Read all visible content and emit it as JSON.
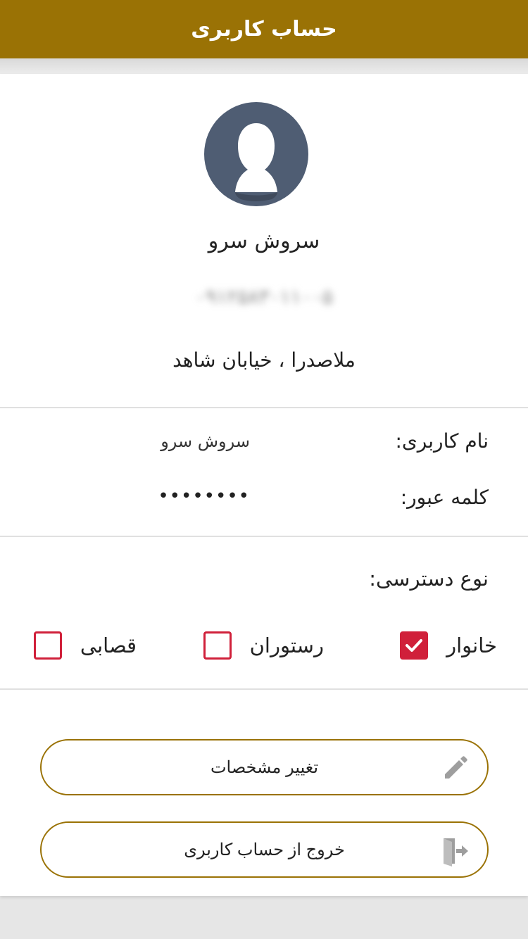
{
  "header": {
    "title": "حساب کاربری"
  },
  "profile": {
    "name": "سروش سرو",
    "phone": "۰۹۱۲۵۸۳۰۱۱۰۰۵",
    "address": "ملاصدرا ، خیابان شاهد",
    "avatar_icon": "user-silhouette-icon"
  },
  "account": {
    "username_label": "نام کاربری:",
    "username_value": "سروش سرو",
    "password_label": "کلمه عبور:",
    "password_value": "••••••••"
  },
  "access": {
    "title": "نوع دسترسی:",
    "options": [
      {
        "label": "خانوار",
        "checked": true
      },
      {
        "label": "رستوران",
        "checked": false
      },
      {
        "label": "قصابی",
        "checked": false
      }
    ]
  },
  "actions": {
    "edit_label": "تغییر مشخصات",
    "edit_icon": "pencil-icon",
    "logout_label": "خروج از حساب کاربری",
    "logout_icon": "exit-door-icon"
  },
  "colors": {
    "app_bar": "#9a7205",
    "accent_red": "#d0203a",
    "avatar_bg": "#4f5d73"
  }
}
